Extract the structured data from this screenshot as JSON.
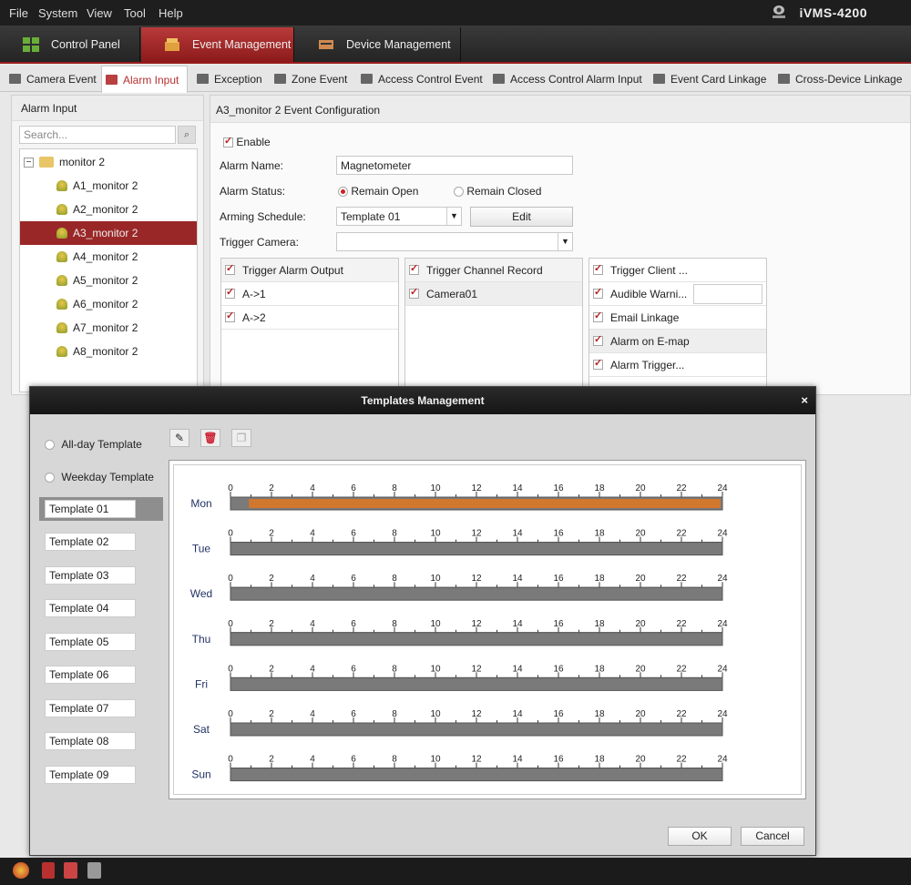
{
  "menu": [
    "File",
    "System",
    "View",
    "Tool",
    "Help"
  ],
  "app_title": "iVMS-4200",
  "modules": [
    {
      "label": "Control Panel",
      "active": false
    },
    {
      "label": "Event Management",
      "active": true
    },
    {
      "label": "Device Management",
      "active": false
    }
  ],
  "subtabs": [
    "Camera Event",
    "Alarm Input",
    "Exception",
    "Zone Event",
    "Access Control Event",
    "Access Control Alarm Input",
    "Event Card Linkage",
    "Cross-Device Linkage"
  ],
  "active_subtab": "Alarm Input",
  "left": {
    "title": "Alarm Input",
    "search_placeholder": "Search...",
    "root": "monitor 2",
    "items": [
      "A1_monitor 2",
      "A2_monitor 2",
      "A3_monitor 2",
      "A4_monitor 2",
      "A5_monitor 2",
      "A6_monitor 2",
      "A7_monitor 2",
      "A8_monitor 2"
    ],
    "selected": "A3_monitor 2"
  },
  "config": {
    "title": "A3_monitor 2 Event Configuration",
    "enable_label": "Enable",
    "alarm_name_label": "Alarm Name:",
    "alarm_name_value": "Magnetometer",
    "alarm_status_label": "Alarm Status:",
    "status_open": "Remain Open",
    "status_closed": "Remain Closed",
    "status_selected": "Remain Open",
    "arming_label": "Arming Schedule:",
    "arming_value": "Template 01",
    "edit_label": "Edit",
    "trigger_camera_label": "Trigger Camera:",
    "trigger_camera_value": "",
    "alarm_output": {
      "header": "Trigger Alarm Output",
      "rows": [
        "A->1",
        "A->2"
      ]
    },
    "channel_record": {
      "header": "Trigger Channel Record",
      "rows": [
        "Camera01"
      ]
    },
    "linkage": {
      "header": "Trigger Client ...",
      "rows": [
        "Audible Warni...",
        "Email Linkage",
        "Alarm on E-map",
        "Alarm Trigger..."
      ]
    }
  },
  "modal": {
    "title": "Templates Management",
    "close": "×",
    "radio_allday": "All-day Template",
    "radio_weekday": "Weekday Template",
    "templates": [
      "Template 01",
      "Template 02",
      "Template 03",
      "Template 04",
      "Template 05",
      "Template 06",
      "Template 07",
      "Template 08",
      "Template 09"
    ],
    "selected_template": "Template 01",
    "ticks": [
      "0",
      "2",
      "4",
      "6",
      "8",
      "10",
      "12",
      "14",
      "16",
      "18",
      "20",
      "22",
      "24"
    ],
    "days": [
      {
        "name": "Mon",
        "segments": [
          {
            "start": 1,
            "end": 24
          }
        ]
      },
      {
        "name": "Tue",
        "segments": []
      },
      {
        "name": "Wed",
        "segments": []
      },
      {
        "name": "Thu",
        "segments": []
      },
      {
        "name": "Fri",
        "segments": []
      },
      {
        "name": "Sat",
        "segments": []
      },
      {
        "name": "Sun",
        "segments": []
      }
    ],
    "ok": "OK",
    "cancel": "Cancel"
  },
  "colors": {
    "accent": "#9a1b1b",
    "schedule_fill": "#d2772e",
    "schedule_track": "#7a7a7a"
  }
}
